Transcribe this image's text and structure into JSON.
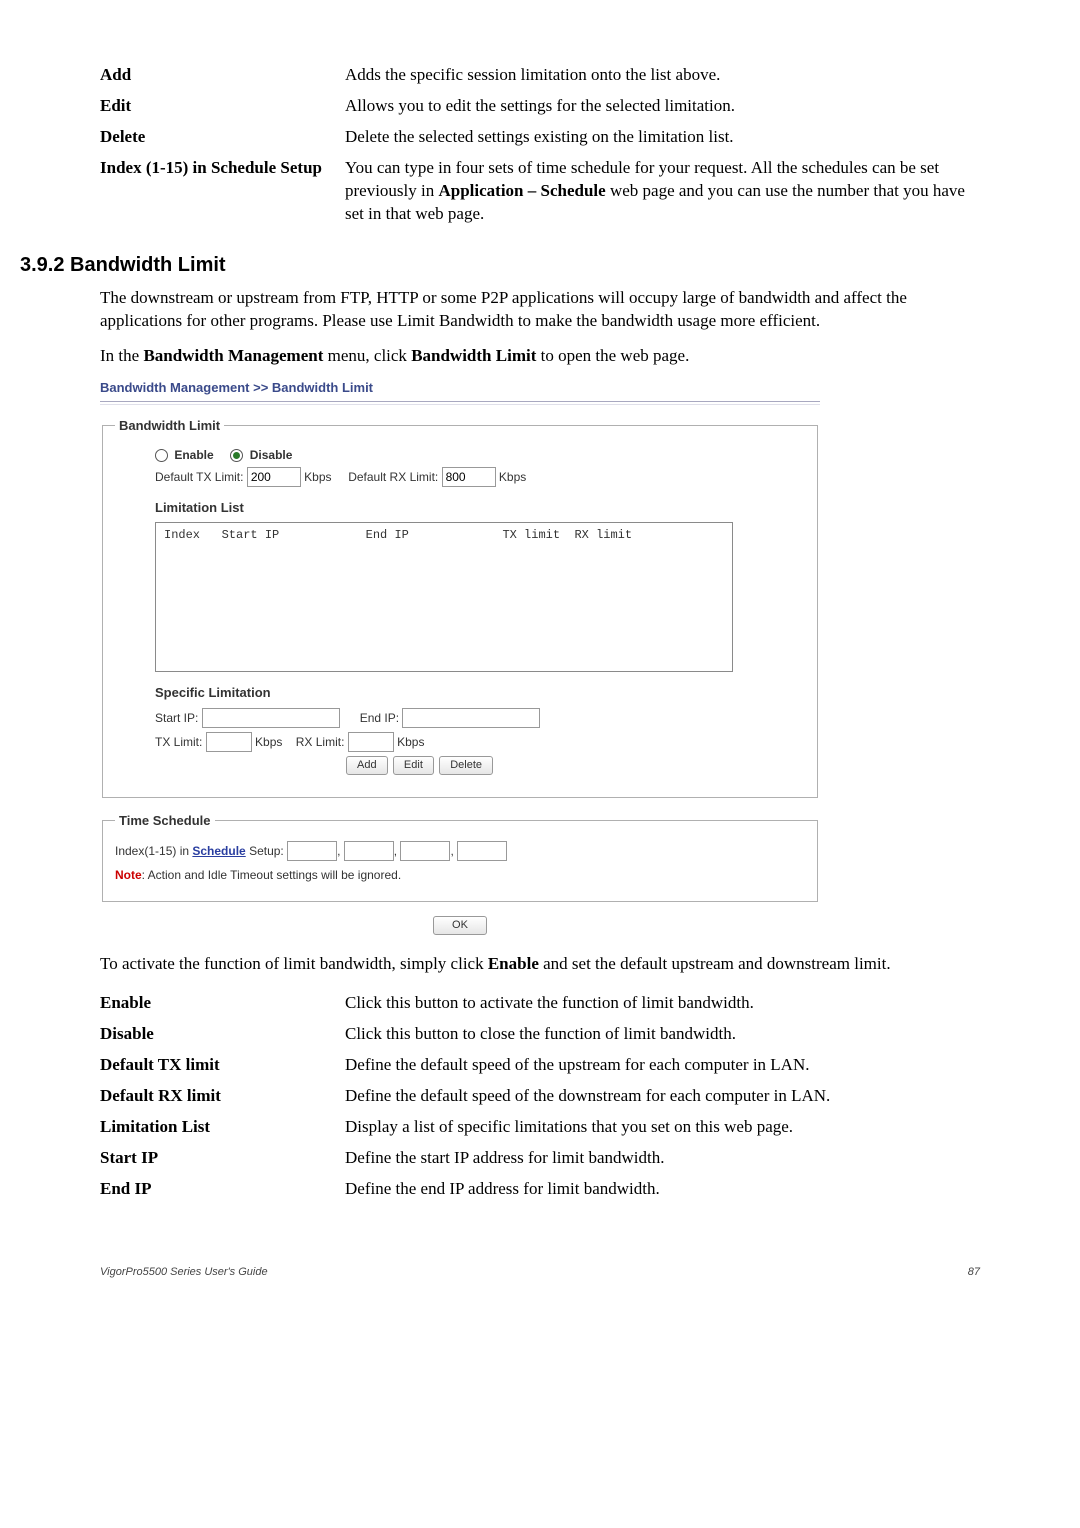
{
  "defs_top": {
    "add": {
      "term": "Add",
      "desc": "Adds the specific session limitation onto the list above."
    },
    "edit": {
      "term": "Edit",
      "desc": "Allows you to edit the settings for the selected limitation."
    },
    "delete": {
      "term": "Delete",
      "desc": "Delete the selected settings existing on the limitation list."
    },
    "schedule": {
      "term": "Index (1-15) in Schedule Setup",
      "d1": "You can type in four sets of time schedule for your request. All the schedules can be set previously in ",
      "d2": "Application – Schedule",
      "d3": " web page and you can use the number that you have set in that web page."
    }
  },
  "section_heading": "3.9.2 Bandwidth Limit",
  "para1": "The downstream or upstream from FTP, HTTP or some P2P applications will occupy large of bandwidth and affect the applications for other programs. Please use Limit Bandwidth to make the bandwidth usage more efficient.",
  "para2_a": "In the ",
  "para2_b": "Bandwidth Management",
  "para2_c": " menu, click ",
  "para2_d": "Bandwidth Limit",
  "para2_e": " to open the web page.",
  "screenshot": {
    "title": "Bandwidth Management >> Bandwidth Limit",
    "legend1": "Bandwidth Limit",
    "enable": "Enable",
    "disable": "Disable",
    "default_tx_label": "Default TX Limit:",
    "default_tx_value": "200",
    "default_rx_label": "Default RX Limit:",
    "default_rx_value": "800",
    "kbps": "Kbps",
    "limitation_list": "Limitation List",
    "list_header": "Index   Start IP            End IP             TX limit  RX limit",
    "specific_limitation": "Specific Limitation",
    "start_ip": "Start IP:",
    "end_ip": "End IP:",
    "tx_limit": "TX Limit:",
    "rx_limit": "RX Limit:",
    "btn_add": "Add",
    "btn_edit": "Edit",
    "btn_delete": "Delete",
    "legend2": "Time Schedule",
    "sched_label_a": "Index(1-15) in ",
    "sched_link": "Schedule",
    "sched_label_b": " Setup:",
    "note_label": "Note",
    "note_text": ": Action and Idle Timeout settings will be ignored.",
    "btn_ok": "OK"
  },
  "para3_a": "To activate the function of limit bandwidth, simply click ",
  "para3_b": "Enable",
  "para3_c": " and set the default upstream and downstream limit.",
  "defs_bottom": {
    "enable": {
      "term": "Enable",
      "desc": "Click this button to activate the function of limit bandwidth."
    },
    "disable": {
      "term": "Disable",
      "desc": "Click this button to close the function of limit bandwidth."
    },
    "def_tx": {
      "term": "Default TX limit",
      "desc": "Define the default speed of the upstream for each computer in LAN."
    },
    "def_rx": {
      "term": "Default RX limit",
      "desc": "Define the default speed of the downstream for each computer in LAN."
    },
    "lim_list": {
      "term": "Limitation List",
      "desc": "Display a list of specific limitations that you set on this web page."
    },
    "start_ip": {
      "term": "Start IP",
      "desc": "Define the start IP address for limit bandwidth."
    },
    "end_ip": {
      "term": "End IP",
      "desc": "Define the end IP address for limit bandwidth."
    }
  },
  "footer": {
    "left": "VigorPro5500 Series User's Guide",
    "right": "87"
  }
}
